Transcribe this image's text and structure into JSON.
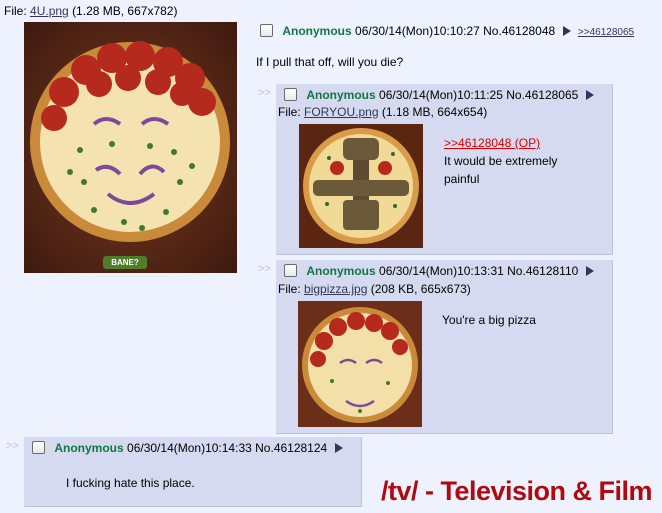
{
  "op": {
    "file_label": "File:",
    "file_name": "4U.png",
    "file_meta": "(1.28 MB, 667x782)",
    "thumb_badge": "BANE?",
    "name": "Anonymous",
    "datetime": "06/30/14(Mon)10:10:27",
    "post_no": "No.46128048",
    "backlink": ">>46128065",
    "comment": "If I pull that off, will you die?"
  },
  "replies": [
    {
      "name": "Anonymous",
      "datetime": "06/30/14(Mon)10:11:25",
      "post_no": "No.46128065",
      "file_label": "File:",
      "file_name": "FORYOU.png",
      "file_meta": "(1.18 MB, 664x654)",
      "quote": ">>46128048 (OP)",
      "comment": "It would be extremely painful"
    },
    {
      "name": "Anonymous",
      "datetime": "06/30/14(Mon)10:13:31",
      "post_no": "No.46128110",
      "file_label": "File:",
      "file_name": "bigpizza.jpg",
      "file_meta": "(208 KB, 665x673)",
      "comment": "You're a big pizza"
    },
    {
      "name": "Anonymous",
      "datetime": "06/30/14(Mon)10:14:33",
      "post_no": "No.46128124",
      "comment": "I fucking hate this place."
    }
  ],
  "side_arrows": ">>",
  "board_title": "/tv/ - Television & Film",
  "colors": {
    "background": "#eef2ff",
    "reply_bg": "#d6daf0",
    "name": "#117743",
    "link": "#34345c",
    "quote": "#dd0000",
    "board_title": "#af0a0f"
  }
}
